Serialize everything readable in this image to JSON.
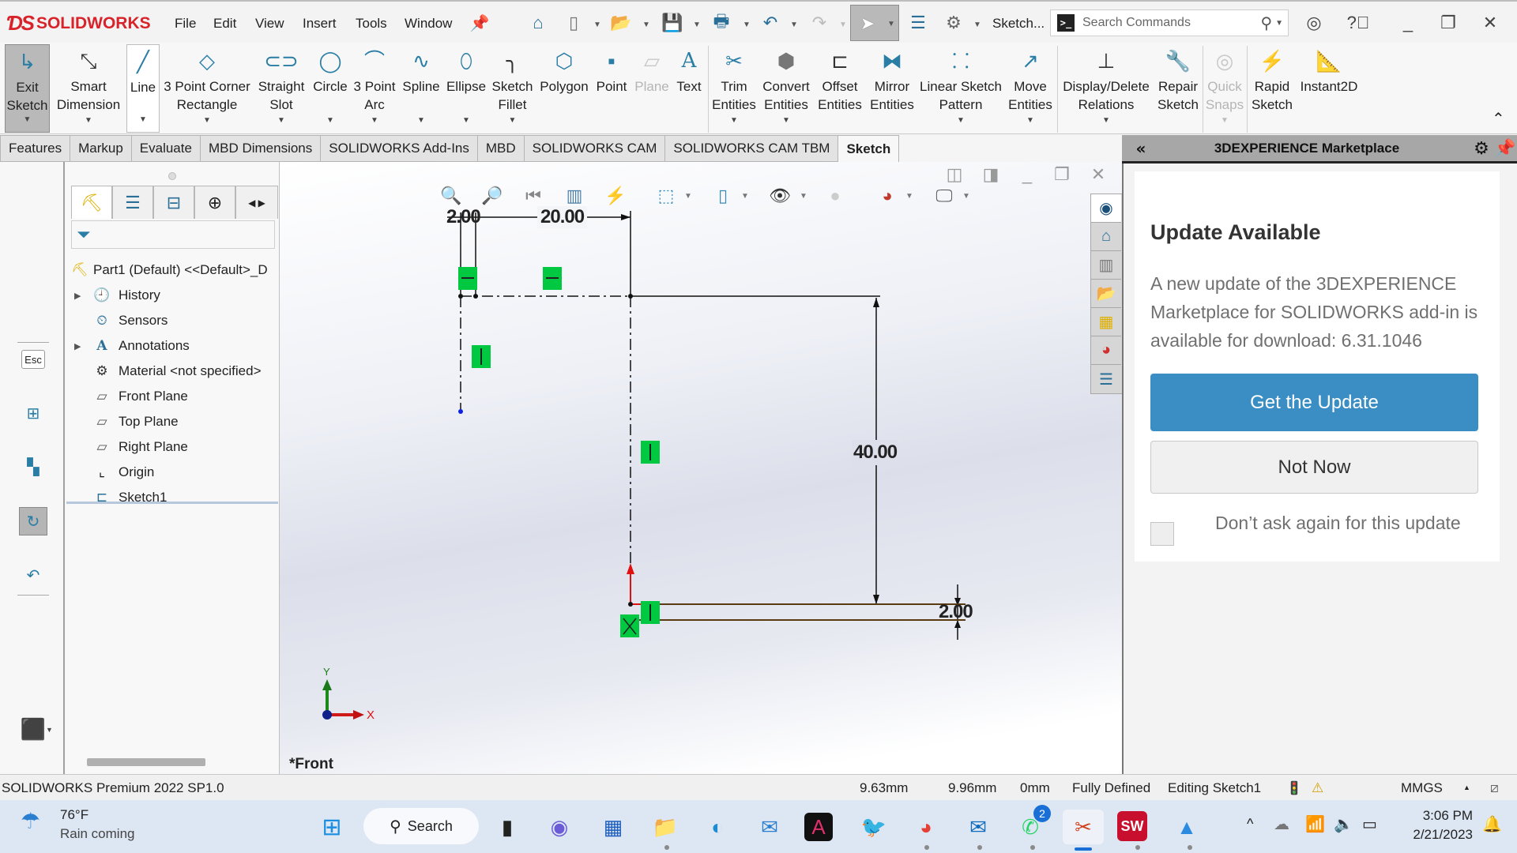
{
  "app": {
    "brand": "SOLIDWORKS",
    "menu": [
      "File",
      "Edit",
      "View",
      "Insert",
      "Tools",
      "Window"
    ],
    "quick_access": {
      "home": "home-icon",
      "new": "new-document-icon",
      "open": "open-icon",
      "save": "save-icon",
      "print": "print-icon",
      "undo": "undo-icon",
      "redo": "redo-icon",
      "select": "select-arrow-icon",
      "file_properties": "file-properties-icon",
      "options": "gear-icon"
    },
    "sketch_dropdown": "Sketch...",
    "search": {
      "placeholder": "Search Commands"
    }
  },
  "ribbon": {
    "buttons": [
      {
        "id": "exit-sketch",
        "line1": "Exit",
        "line2": "Sketch"
      },
      {
        "id": "smart-dimension",
        "line1": "Smart",
        "line2": "Dimension"
      },
      {
        "id": "line",
        "line1": "Line",
        "line2": ""
      },
      {
        "id": "corner-rectangle",
        "line1": "3 Point Corner",
        "line2": "Rectangle"
      },
      {
        "id": "straight-slot",
        "line1": "Straight",
        "line2": "Slot"
      },
      {
        "id": "circle",
        "line1": "Circle",
        "line2": ""
      },
      {
        "id": "three-point-arc",
        "line1": "3 Point",
        "line2": "Arc"
      },
      {
        "id": "spline",
        "line1": "Spline",
        "line2": ""
      },
      {
        "id": "ellipse",
        "line1": "Ellipse",
        "line2": ""
      },
      {
        "id": "sketch-fillet",
        "line1": "Sketch",
        "line2": "Fillet"
      },
      {
        "id": "polygon",
        "line1": "Polygon",
        "line2": ""
      },
      {
        "id": "point",
        "line1": "Point",
        "line2": ""
      },
      {
        "id": "plane",
        "line1": "Plane",
        "line2": ""
      },
      {
        "id": "text",
        "line1": "Text",
        "line2": ""
      },
      {
        "id": "trim-entities",
        "line1": "Trim",
        "line2": "Entities"
      },
      {
        "id": "convert-entities",
        "line1": "Convert",
        "line2": "Entities"
      },
      {
        "id": "offset-entities",
        "line1": "Offset",
        "line2": "Entities"
      },
      {
        "id": "mirror-entities",
        "line1": "Mirror",
        "line2": "Entities"
      },
      {
        "id": "linear-sketch-pattern",
        "line1": "Linear Sketch",
        "line2": "Pattern"
      },
      {
        "id": "move-entities",
        "line1": "Move",
        "line2": "Entities"
      },
      {
        "id": "display-delete-relations",
        "line1": "Display/Delete",
        "line2": "Relations"
      },
      {
        "id": "repair-sketch",
        "line1": "Repair",
        "line2": "Sketch"
      },
      {
        "id": "quick-snaps",
        "line1": "Quick",
        "line2": "Snaps"
      },
      {
        "id": "rapid-sketch",
        "line1": "Rapid",
        "line2": "Sketch"
      },
      {
        "id": "instant2d",
        "line1": "Instant2D",
        "line2": ""
      }
    ]
  },
  "tabs": [
    "Features",
    "Markup",
    "Evaluate",
    "MBD Dimensions",
    "SOLIDWORKS Add-Ins",
    "MBD",
    "SOLIDWORKS CAM",
    "SOLIDWORKS CAM TBM",
    "Sketch"
  ],
  "active_tab": "Sketch",
  "feature_tree": {
    "root": "Part1 (Default) <<Default>_D",
    "items": [
      {
        "label": "History",
        "icon": "history-folder-icon",
        "expandable": true
      },
      {
        "label": "Sensors",
        "icon": "sensors-folder-icon",
        "expandable": false
      },
      {
        "label": "Annotations",
        "icon": "annotations-folder-icon",
        "expandable": true
      },
      {
        "label": "Material <not specified>",
        "icon": "material-icon",
        "expandable": false
      },
      {
        "label": "Front Plane",
        "icon": "plane-icon",
        "expandable": false
      },
      {
        "label": "Top Plane",
        "icon": "plane-icon",
        "expandable": false
      },
      {
        "label": "Right Plane",
        "icon": "plane-icon",
        "expandable": false
      },
      {
        "label": "Origin",
        "icon": "origin-icon",
        "expandable": false
      },
      {
        "label": "Sketch1",
        "icon": "sketch-icon",
        "expandable": false
      }
    ]
  },
  "left_toolbar": {
    "esc_label": "Esc"
  },
  "viewport": {
    "view_label": "*Front",
    "dimensions": {
      "top_left": "2.00",
      "top_width": "20.00",
      "height": "40.00",
      "bottom_thickness": "2.00"
    },
    "triad": {
      "x": "X",
      "y": "Y"
    }
  },
  "marketplace": {
    "header": "3DEXPERIENCE Marketplace",
    "title": "Update Available",
    "message": "A new update of the 3DEXPERIENCE Marketplace for SOLIDWORKS add-in is available for download: 6.31.1046",
    "primary_button": "Get the Update",
    "secondary_button": "Not Now",
    "checkbox_label": "Don’t ask again for this update",
    "checkbox_checked": false,
    "accent_color": "#3b8ec4"
  },
  "status_bar": {
    "product": "SOLIDWORKS Premium 2022 SP1.0",
    "x": "9.63mm",
    "y": "9.96mm",
    "z": "0mm",
    "state": "Fully Defined",
    "mode": "Editing Sketch1",
    "units": "MMGS"
  },
  "taskbar": {
    "weather_temp": "76°F",
    "weather_desc": "Rain coming",
    "search_label": "Search",
    "whatsapp_badge": "2",
    "time": "3:06 PM",
    "date": "2/21/2023"
  }
}
